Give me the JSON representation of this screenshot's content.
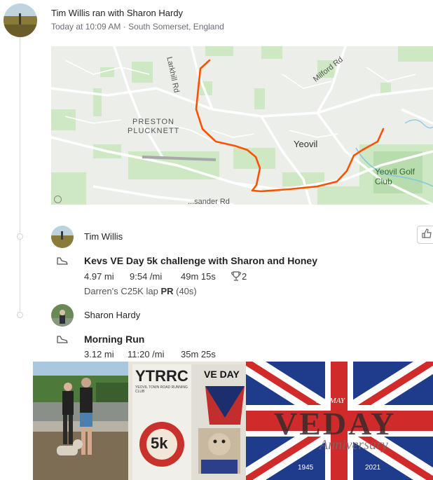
{
  "header": {
    "title": "Tim Willis ran with Sharon Hardy",
    "meta": "Today at 10:09 AM · South Somerset, England"
  },
  "map": {
    "labels": {
      "larkhill": "Larkhill Rd",
      "milford": "Milford Rd",
      "preston1": "PRESTON",
      "preston2": "PLUCKNETT",
      "yeovil": "Yeovil",
      "golf": "Yeovil Golf Club",
      "lysander": "...sander Rd"
    },
    "route_color": "#fc5200"
  },
  "activity1": {
    "athlete": "Tim Willis",
    "name": "Kevs VE Day 5k challenge with Sharon and Honey",
    "distance": "4.97 mi",
    "pace": "9:54 /mi",
    "time": "49m 15s",
    "trophies": "2",
    "lap_text": "Darren's C25K lap",
    "lap_pr": "PR",
    "lap_time": "(40s)"
  },
  "activity2": {
    "athlete": "Sharon Hardy",
    "name": "Morning Run",
    "distance": "3.12 mi",
    "pace": "11:20 /mi",
    "time": "35m 25s"
  },
  "photos": {
    "poster_brand": "YTRRC",
    "poster_subtitle": "YEOVIL TOWN ROAD RUNNING CLUB",
    "poster_ve": "VE DAY",
    "poster_5k": "5k",
    "flag_date": "8 th MAY",
    "flag_ve": "VEDAY",
    "flag_anniv": "Anniversary",
    "flag_y1": "1945",
    "flag_y2": "2021"
  }
}
